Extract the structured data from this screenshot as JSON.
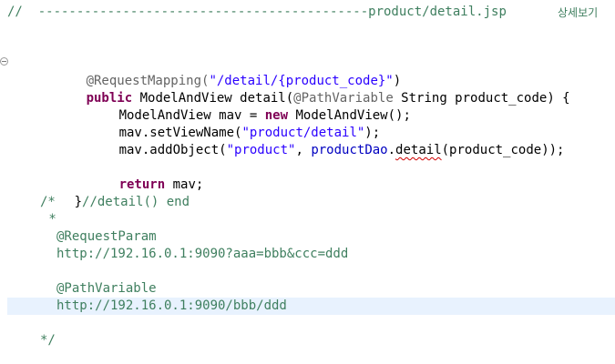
{
  "editor": {
    "header_comment": "//  -------------------------------------------product/detail.jsp ",
    "header_korean": "상세보기",
    "annotation_line": "@RequestMapping(",
    "mapping_value": "\"/detail/{product_code}\"",
    "close_paren": ")",
    "public_kw": "public",
    "method_sig_a": " ModelAndView detail(",
    "path_variable": "@PathVariable",
    "method_sig_b": " String product_code) {",
    "mav_decl_a": "ModelAndView mav = ",
    "new_kw": "new",
    "mav_decl_b": " ModelAndView();",
    "set_view_a": "mav.setViewName(",
    "set_view_str": "\"product/detail\"",
    "set_view_b": ");",
    "add_obj_a": "mav.addObject(",
    "add_obj_str": "\"product\"",
    "add_obj_b": ", ",
    "add_obj_field": "productDao",
    "add_obj_dot": ".",
    "add_obj_detail": "detail",
    "add_obj_c": "(product_code));",
    "return_kw": "return",
    "return_rest": " mav;",
    "end_brace": "}",
    "end_comment": "//detail() end",
    "block_open": "/*",
    "block_star": " *",
    "request_param": "@RequestParam",
    "request_param_url": "http://192.16.0.1:9090?aaa=bbb&ccc=ddd",
    "path_variable_note": "@PathVariable",
    "path_variable_url": "http://192.16.0.1:9090/bbb/ddd",
    "block_close": "*/"
  }
}
